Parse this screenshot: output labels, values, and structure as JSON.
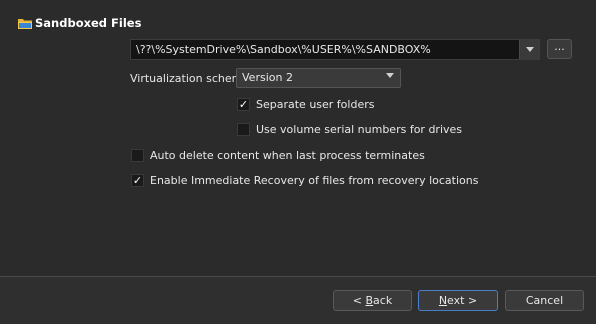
{
  "header": {
    "title": "Sandboxed Files",
    "icon": "folder-icon"
  },
  "path": {
    "value": "\\??\\%SystemDrive%\\Sandbox\\%USER%\\%SANDBOX%",
    "browse_label": "..."
  },
  "scheme": {
    "label": "Virtualization scheme",
    "selected": "Version 2"
  },
  "options": [
    {
      "label": "Separate user folders",
      "checked": true
    },
    {
      "label": "Use volume serial numbers for drives",
      "checked": false
    },
    {
      "label": "Auto delete content when last process terminates",
      "checked": false
    },
    {
      "label": "Enable Immediate Recovery of files from recovery locations",
      "checked": true
    }
  ],
  "buttons": {
    "back": {
      "prefix": "< ",
      "mnemonic": "B",
      "rest": "ack"
    },
    "next": {
      "mnemonic": "N",
      "rest": "ext >"
    },
    "cancel": "Cancel"
  },
  "colors": {
    "background": "#2b2b2b",
    "input_background": "#141414",
    "accent_border": "#4a7fc7",
    "folder_yellow": "#e8b33a",
    "folder_blue": "#3a86d6"
  }
}
